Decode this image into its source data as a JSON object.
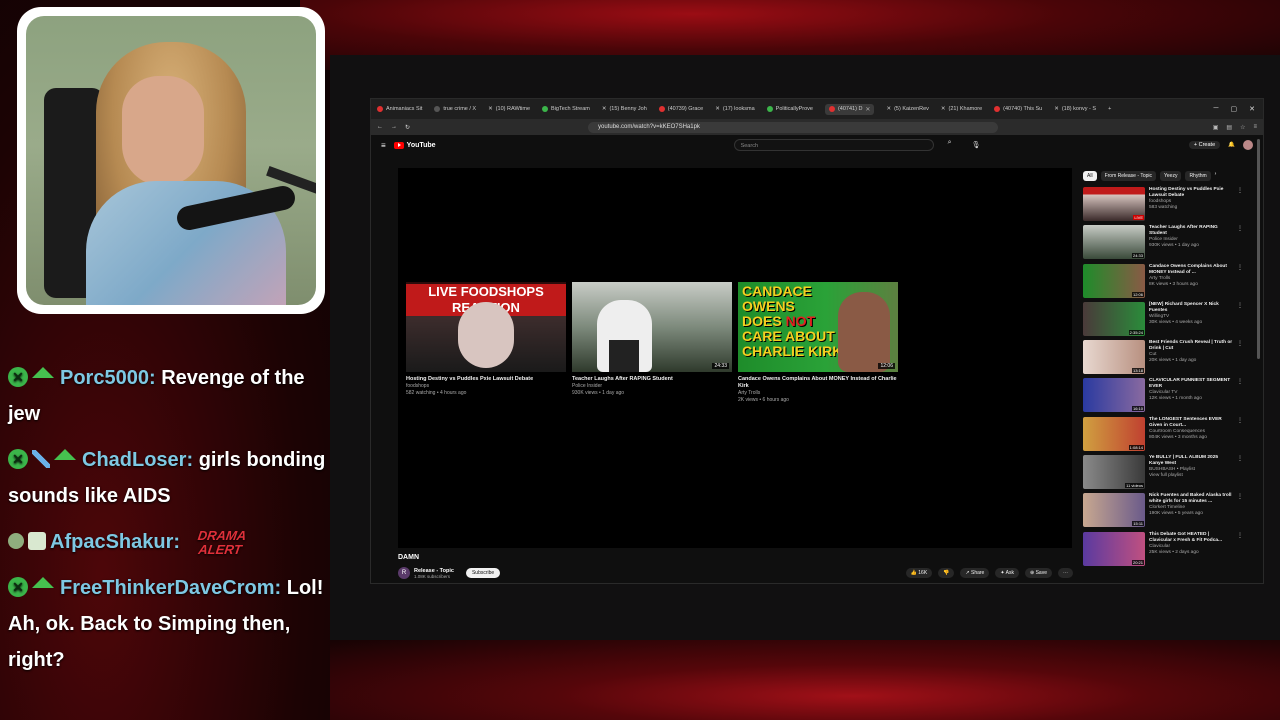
{
  "stream": {
    "chat": [
      {
        "user": "Porc5000:",
        "text": "Revenge of the jew",
        "badges": [
          "x-icon",
          "gem-icon"
        ]
      },
      {
        "user": "ChadLoser:",
        "text": "girls bonding sounds like AIDS",
        "badges": [
          "x-icon",
          "sword-icon",
          "gem-icon"
        ]
      },
      {
        "user": "AfpacShakur:",
        "text": "",
        "badges": [
          "dot-icon",
          "pen-icon"
        ],
        "emote": "DRAMA ALERT"
      },
      {
        "user": "FreeThinkerDaveCrom:",
        "text": "Lol! Ah, ok. Back to Simping then, right?",
        "badges": [
          "x-icon",
          "gem-icon"
        ]
      }
    ],
    "colors": {
      "username": "#7ec8e3",
      "badge_green": "#3bb54a",
      "bg_red": "#9b0d14"
    }
  },
  "browser": {
    "tabs": [
      {
        "label": "Animaniacs Sit"
      },
      {
        "label": "true crime / X"
      },
      {
        "label": "(10) RAWtime"
      },
      {
        "label": "BigTech Stream"
      },
      {
        "label": "(15) Benny Joh"
      },
      {
        "label": "(40739) Grace"
      },
      {
        "label": "(17) looksma"
      },
      {
        "label": "PoliticallyProve"
      },
      {
        "label": "(40741) D"
      },
      {
        "label": "(5) KaizenRev"
      },
      {
        "label": "(21) Khamore"
      },
      {
        "label": "(40740) This Su"
      },
      {
        "label": "(18) konvy - S"
      }
    ],
    "url": "youtube.com/watch?v=kKEO7SHa1pk"
  },
  "youtube": {
    "logo": "YouTube",
    "search_placeholder": "Search",
    "create_label": "Create",
    "endscreen": [
      {
        "title": "Hosting Destiny vs Puddles Pxie Lawsuit Debate",
        "channel": "foodshops",
        "meta": "582 watching • 4 hours ago",
        "banner": "LIVE FOODSHOPS REACTION"
      },
      {
        "title": "Teacher Laughs After RAPING Student",
        "channel": "Police Insider",
        "meta": "930K views • 1 day ago",
        "duration": "24:33"
      },
      {
        "title": "Candace Owens Complains About MONEY Instead of Charlie Kirk",
        "channel": "Arty Trolls",
        "meta": "2K views • 6 hours ago",
        "duration": "12:06",
        "thumb_text_1": "CANDACE",
        "thumb_text_2": "OWENS",
        "thumb_text_3": "DOES",
        "thumb_text_not": "NOT",
        "thumb_text_4": "CARE ABOUT",
        "thumb_text_5": "CHARLIE KIRK"
      }
    ],
    "video_title": "DAMN",
    "channel": {
      "name": "Release - Topic",
      "subs": "1.08K subscribers",
      "avatar_letter": "R"
    },
    "subscribe_label": "Subscribe",
    "actions": {
      "like": "16K",
      "share": "Share",
      "ask": "Ask",
      "save": "Save"
    },
    "chips": [
      "All",
      "From Release - Topic",
      "Yeezy",
      "Rhythm"
    ],
    "recs": [
      {
        "title": "Hosting Destiny vs Puddles Pxie Lawsuit Debate",
        "channel": "foodshops",
        "meta": "583 watching",
        "tag": "LIVE"
      },
      {
        "title": "Teacher Laughs After RAPING Student",
        "channel": "Police Insider",
        "meta": "930K views • 1 day ago",
        "duration": "24:33"
      },
      {
        "title": "Candace Owens Complains About MONEY Instead of ...",
        "channel": "Arty Trolls",
        "meta": "8K views • 3 hours ago",
        "duration": "12:06"
      },
      {
        "title": "[NEW] Richard Spencer X Nick Fuentes",
        "channel": "WillingTV",
        "meta": "30K views • 4 weeks ago",
        "duration": "2:35:24"
      },
      {
        "title": "Best Friends Crush Reveal | Truth or Drink | Cut",
        "channel": "Cut",
        "meta": "20K views • 1 day ago",
        "duration": "13:18"
      },
      {
        "title": "CLAVICULAR FUNNIEST SEGMENT EVER",
        "channel": "Clavicular TV",
        "meta": "12K views • 1 month ago",
        "duration": "16:10"
      },
      {
        "title": "The LONGEST Sentences EVER Given in Court...",
        "channel": "Courtroom Consequences",
        "meta": "804K views • 3 months ago",
        "duration": "1:08:14"
      },
      {
        "title": "Ye BULLY | FULL ALBUM 2025 Kanye West",
        "channel": "BUSHBASH • Playlist",
        "meta": "View full playlist",
        "duration": "11 videos"
      },
      {
        "title": "Nick Fuentes and Baked Alaska troll white girls for 15 minutes ...",
        "channel": "Clorkert Timeline",
        "meta": "190K views • 5 years ago",
        "duration": "15:11"
      },
      {
        "title": "This Debate Got HEATED | Clavicular x Fresh & Fit Podca...",
        "channel": "Clavicular",
        "meta": "25K views • 2 days ago",
        "duration": "20:21"
      }
    ]
  }
}
